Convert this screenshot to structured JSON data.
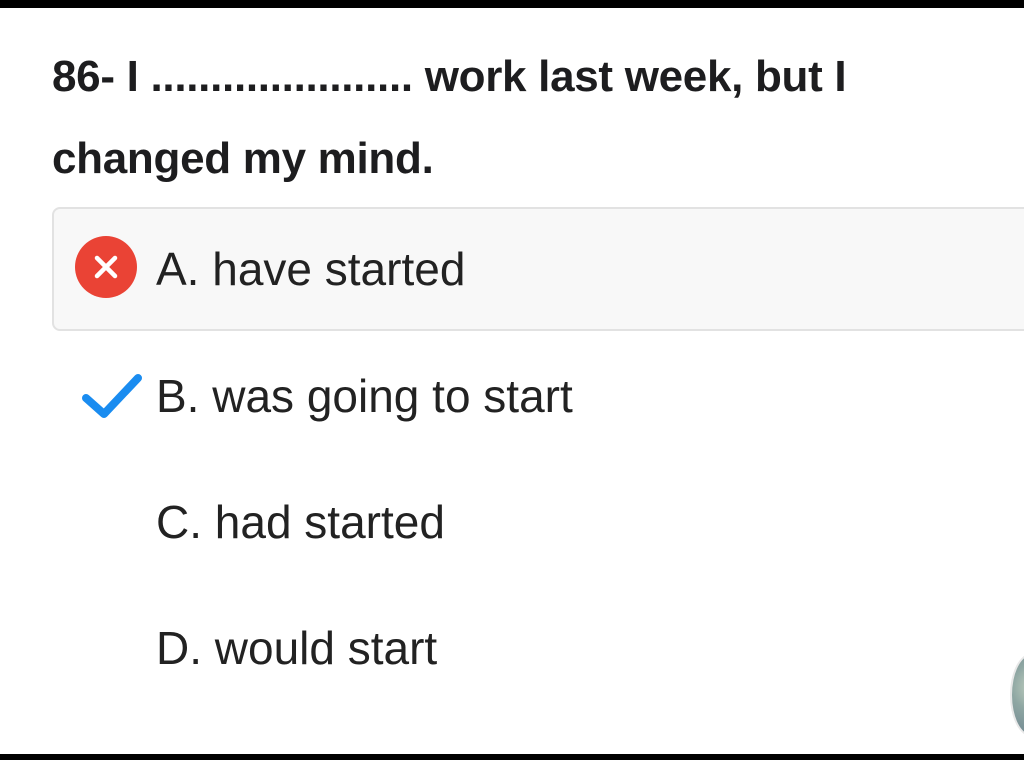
{
  "question": {
    "text": "86- I ...................... work last week, but I changed my mind."
  },
  "options": [
    {
      "label": "A. have started",
      "state": "selected-wrong",
      "icon": "wrong-x-icon"
    },
    {
      "label": "B. was going to start",
      "state": "correct",
      "icon": "correct-check-icon"
    },
    {
      "label": "C. had started",
      "state": "none"
    },
    {
      "label": "D. would start",
      "state": "none"
    }
  ],
  "colors": {
    "wrong": "#ea4335",
    "correct": "#1a8cf0",
    "selected_bg": "#f8f8f8"
  }
}
